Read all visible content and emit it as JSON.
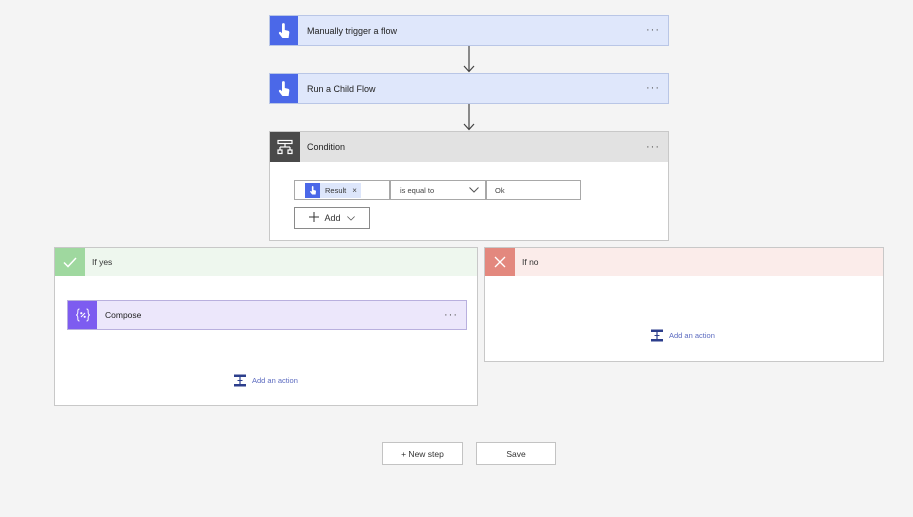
{
  "steps": [
    {
      "title": "Manually trigger a flow",
      "menu": "···"
    },
    {
      "title": "Run a Child Flow",
      "menu": "···"
    }
  ],
  "condition": {
    "title": "Condition",
    "menu": "···",
    "token_label": "Result",
    "token_remove": "×",
    "operator": "is equal to",
    "value": "Ok",
    "add_label": "Add"
  },
  "yes_branch": {
    "title": "If yes",
    "compose": {
      "title": "Compose",
      "menu": "···"
    },
    "add_action": "Add an action"
  },
  "no_branch": {
    "title": "If no",
    "add_action": "Add an action"
  },
  "footer": {
    "new_step": "+ New step",
    "save": "Save"
  },
  "colors": {
    "trigger_icon": "#4b68e8",
    "condition_icon": "#4a4a4a",
    "yes_header": "#eef7ee",
    "yes_icon": "#9fd89f",
    "no_header": "#fbecea",
    "no_icon": "#e3887e",
    "compose_icon": "#7d5cf0",
    "link": "#5c6bc0"
  }
}
